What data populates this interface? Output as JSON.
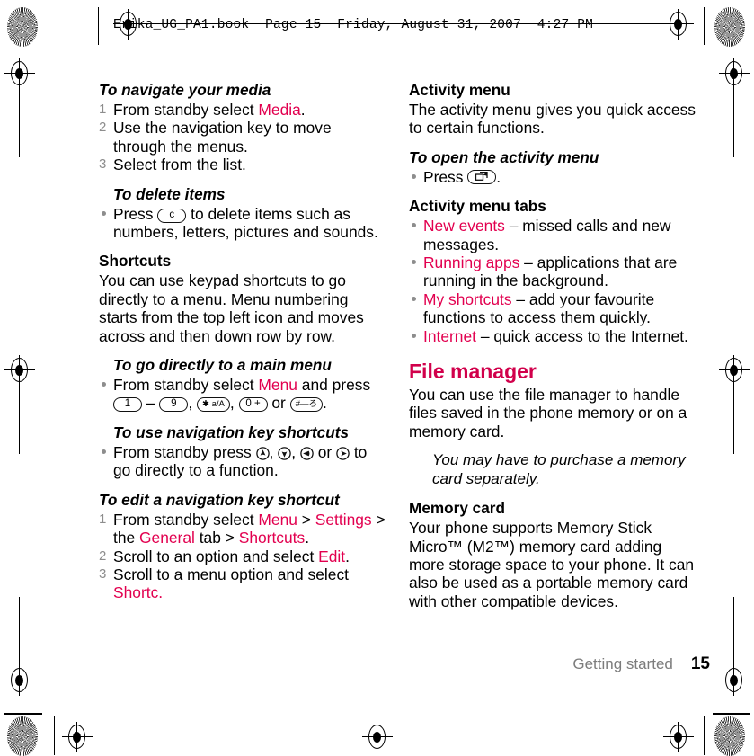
{
  "header": {
    "file_line": "Erika_UG_PA1.book  Page 15  Friday, August 31, 2007  4:27 PM"
  },
  "colors": {
    "accent_pink": "#e2004f",
    "chapter_heading": "#d1004b",
    "marker_gray": "#8d8d8d",
    "footer_gray": "#7c7c7c"
  },
  "left_column": {
    "navigate_media": {
      "heading": "To navigate your media",
      "steps": [
        {
          "num": "1",
          "pre": "From standby select ",
          "link": "Media",
          "post": "."
        },
        {
          "num": "2",
          "pre": "Use the navigation key to move through the menus.",
          "link": "",
          "post": ""
        },
        {
          "num": "3",
          "pre": "Select from the list.",
          "link": "",
          "post": ""
        }
      ]
    },
    "delete_items": {
      "heading": "To delete items",
      "bullet_pre": "Press ",
      "key_label": "c",
      "bullet_post": " to delete items such as numbers, letters, pictures and sounds."
    },
    "shortcuts": {
      "heading": "Shortcuts",
      "body": "You can use keypad shortcuts to go directly to a menu. Menu numbering starts from the top left icon and moves across and then down row by row."
    },
    "main_menu": {
      "heading": "To go directly to a main menu",
      "pre": "From standby select ",
      "link": "Menu",
      "mid": " and press ",
      "key1": "1",
      "dash": " – ",
      "key2": "9",
      "sep1": ", ",
      "key3": "✱ a/A",
      "sep2": ", ",
      "key4": "0 +",
      "or": " or ",
      "key5": "#—ろ",
      "end": "."
    },
    "nav_shortcuts": {
      "heading": "To use navigation key shortcuts",
      "pre": "From standby press ",
      "sep1": ", ",
      "sep2": ", ",
      "or": " or ",
      "post": " to go directly to a function."
    },
    "edit_nav_shortcut": {
      "heading": "To edit a navigation key shortcut",
      "steps": [
        {
          "num": "1",
          "parts": [
            {
              "t": "From standby select ",
              "pink": false
            },
            {
              "t": "Menu",
              "pink": true
            },
            {
              "t": " > ",
              "pink": false
            },
            {
              "t": "Settings",
              "pink": true
            },
            {
              "t": " > the ",
              "pink": false
            },
            {
              "t": "General",
              "pink": true
            },
            {
              "t": " tab > ",
              "pink": false
            },
            {
              "t": "Shortcuts",
              "pink": true
            },
            {
              "t": ".",
              "pink": false
            }
          ]
        },
        {
          "num": "2",
          "parts": [
            {
              "t": "Scroll to an option and select ",
              "pink": false
            },
            {
              "t": "Edit",
              "pink": true
            },
            {
              "t": ".",
              "pink": false
            }
          ]
        },
        {
          "num": "3",
          "parts": [
            {
              "t": "Scroll to a menu option and select ",
              "pink": false
            },
            {
              "t": "Shortc.",
              "pink": true
            }
          ]
        }
      ]
    }
  },
  "right_column": {
    "activity_menu": {
      "heading": "Activity menu",
      "body": "The activity menu gives you quick access to certain functions."
    },
    "open_activity_menu": {
      "heading": "To open the activity menu",
      "pre": "Press ",
      "post": "."
    },
    "activity_menu_tabs": {
      "heading": "Activity menu tabs",
      "items": [
        {
          "link": "New events",
          "text": " – missed calls and new messages."
        },
        {
          "link": "Running apps",
          "text": " – applications that are running in the background."
        },
        {
          "link": "My shortcuts",
          "text": " – add your favourite functions to access them quickly."
        },
        {
          "link": "Internet",
          "text": " – quick access to the Internet."
        }
      ]
    },
    "file_manager": {
      "heading": "File manager",
      "body": "You can use the file manager to handle files saved in the phone memory or on a memory card.",
      "note": "You may have to purchase a memory card separately."
    },
    "memory_card": {
      "heading": "Memory card",
      "body": "Your phone supports Memory Stick Micro™ (M2™) memory card adding more storage space to your phone. It can also be used as a portable memory card with other compatible devices."
    }
  },
  "footer": {
    "chapter": "Getting started",
    "page_number": "15"
  }
}
